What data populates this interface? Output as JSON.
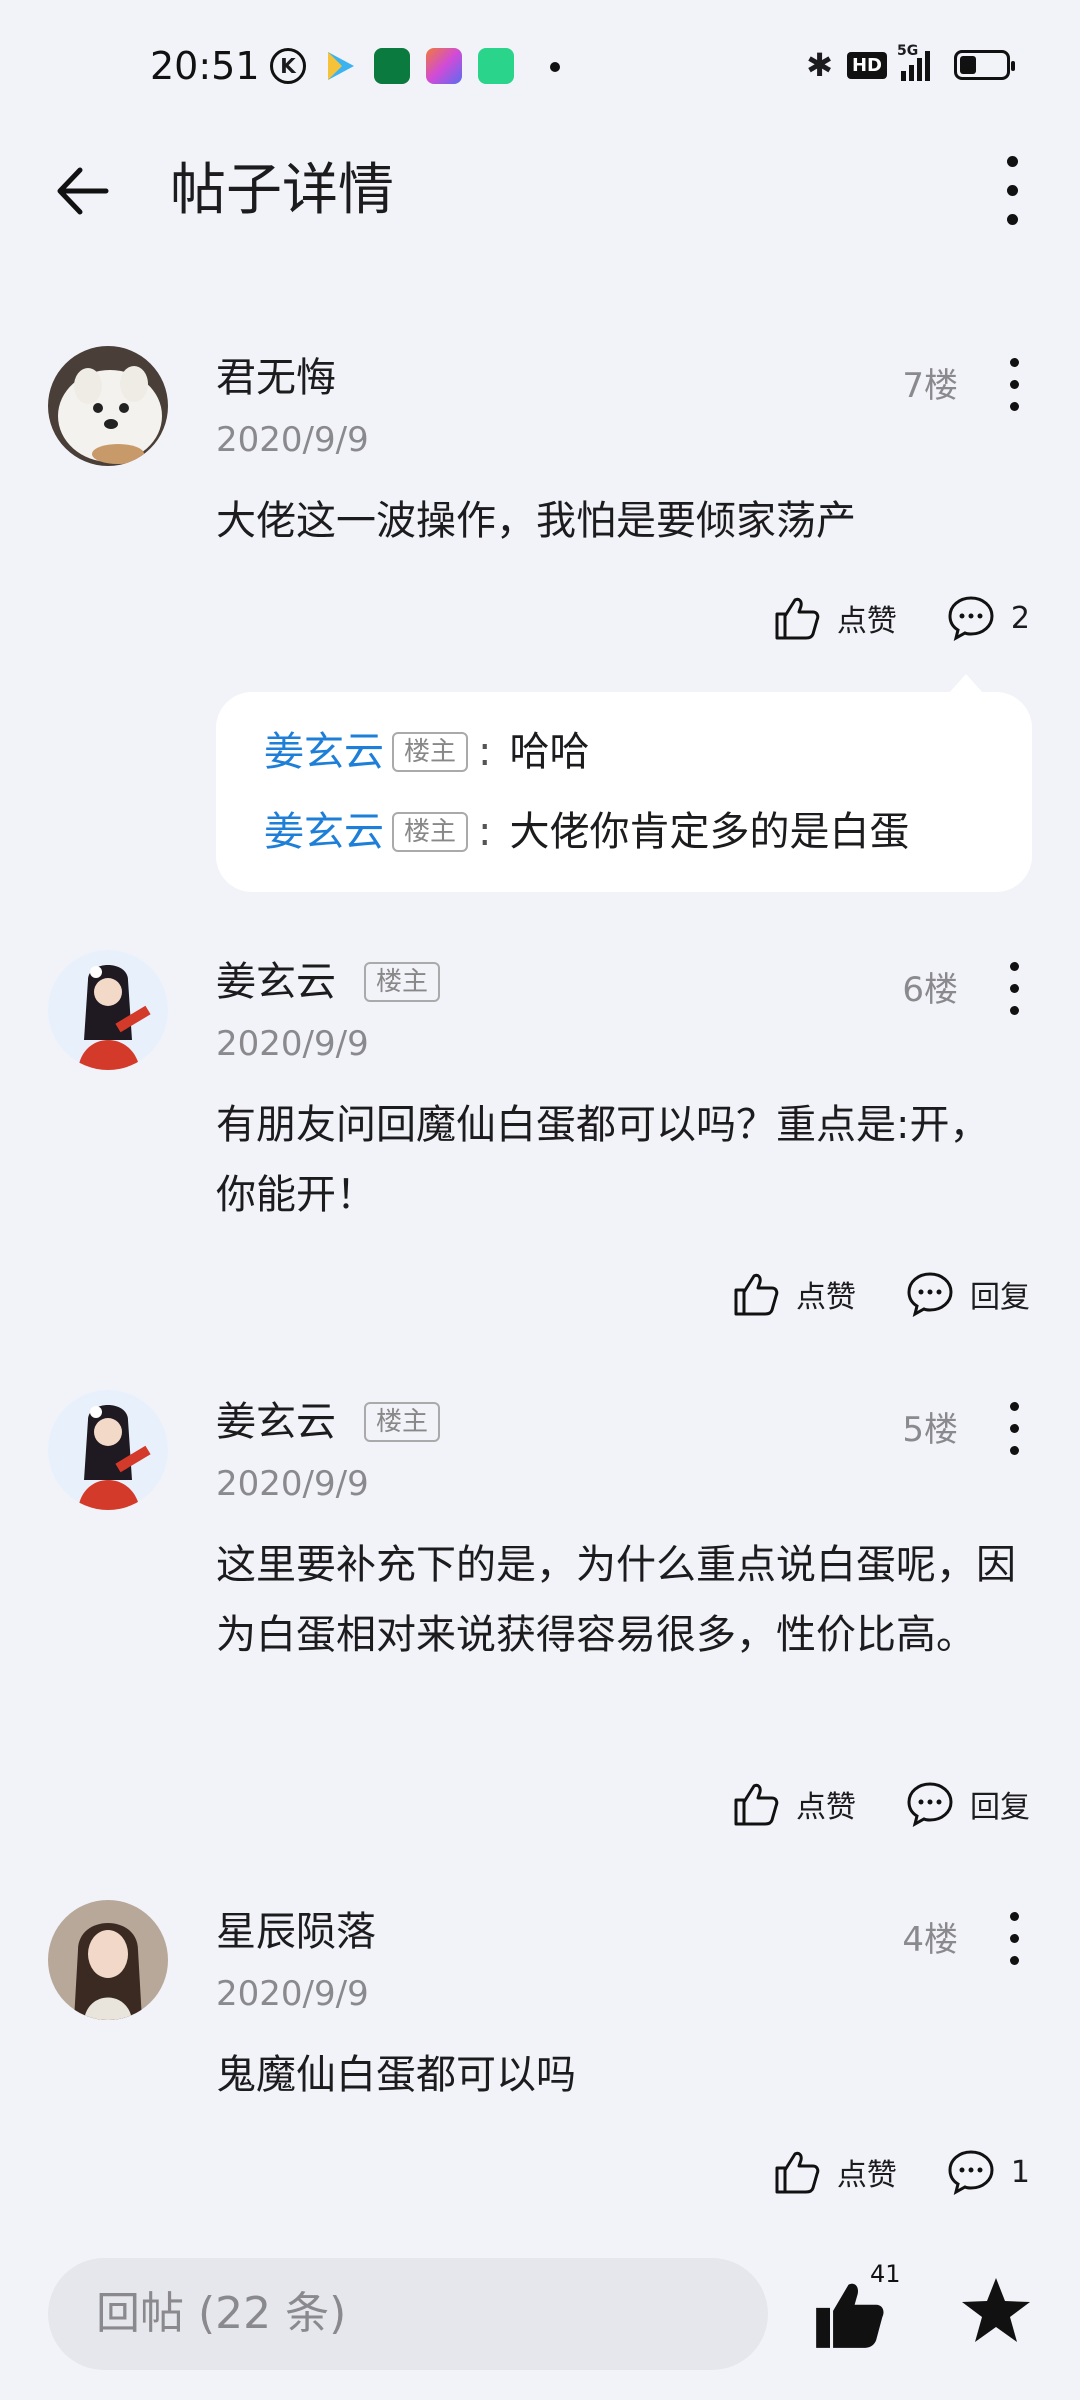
{
  "status_bar": {
    "time": "20:51",
    "network": "5G",
    "hd": "HD"
  },
  "header": {
    "title": "帖子详情"
  },
  "posts": [
    {
      "user": "君无悔",
      "is_host": false,
      "date": "2020/9/9",
      "floor": "7楼",
      "content": "大佬这一波操作，我怕是要倾家荡产",
      "like_label": "点赞",
      "comment_label": "2",
      "replies": [
        {
          "user": "姜玄云",
          "badge": "楼主",
          "colon": ":",
          "text": "哈哈"
        },
        {
          "user": "姜玄云",
          "badge": "楼主",
          "colon": ":",
          "text": "大佬你肯定多的是白蛋"
        }
      ]
    },
    {
      "user": "姜玄云",
      "is_host": true,
      "badge": "楼主",
      "date": "2020/9/9",
      "floor": "6楼",
      "content": "有朋友问回魔仙白蛋都可以吗？重点是:开，你能开！",
      "like_label": "点赞",
      "comment_label": "回复"
    },
    {
      "user": "姜玄云",
      "is_host": true,
      "badge": "楼主",
      "date": "2020/9/9",
      "floor": "5楼",
      "content": "这里要补充下的是，为什么重点说白蛋呢，因为白蛋相对来说获得容易很多，性价比高。",
      "like_label": "点赞",
      "comment_label": "回复"
    },
    {
      "user": "星辰陨落",
      "is_host": false,
      "date": "2020/9/9",
      "floor": "4楼",
      "content": "鬼魔仙白蛋都可以吗",
      "like_label": "点赞",
      "comment_label": "1"
    }
  ],
  "bottom_bar": {
    "reply_placeholder": "回帖 (22 条)",
    "like_count": "41"
  },
  "icons": [
    "back-arrow-icon",
    "more-vertical-icon",
    "thumbs-up-icon",
    "comment-bubble-icon",
    "star-icon"
  ]
}
